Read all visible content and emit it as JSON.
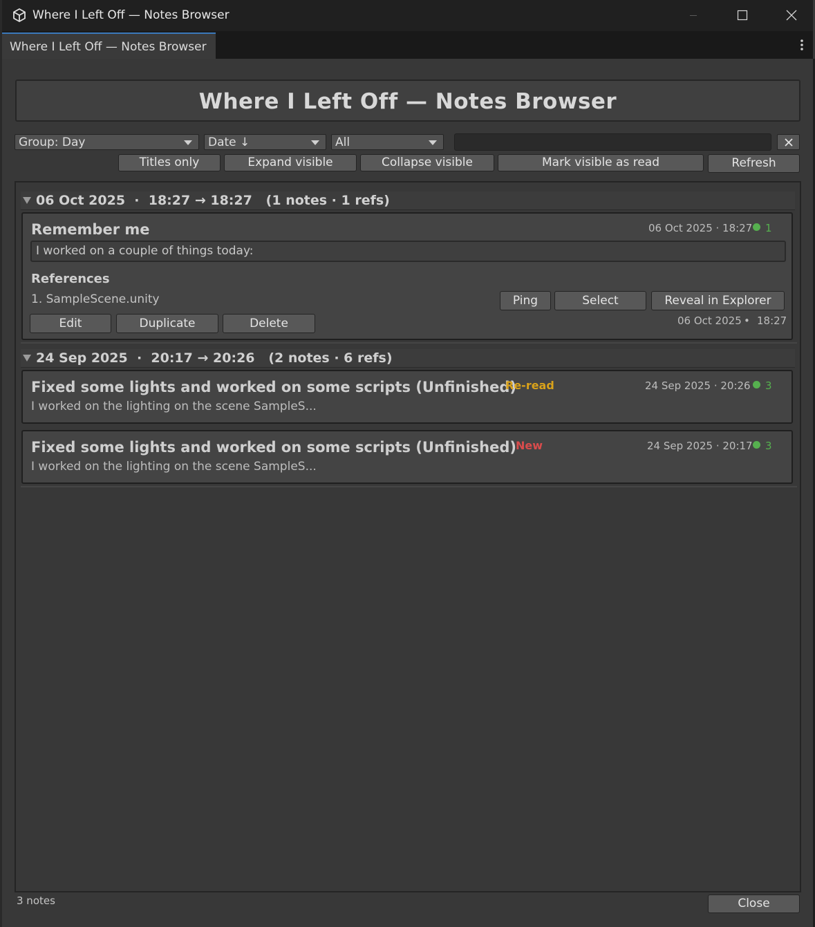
{
  "window": {
    "title": "Where I Left Off — Notes Browser",
    "tab_label": "Where I Left Off — Notes Browser",
    "header_title": "Where I Left Off — Notes Browser"
  },
  "toolbar": {
    "group_dropdown": "Group: Day",
    "sort_dropdown": "Date ↓",
    "filter_dropdown": "All",
    "search_value": "",
    "clear_label": "✕",
    "titles_only": "Titles only",
    "expand_visible": "Expand visible",
    "collapse_visible": "Collapse visible",
    "mark_visible_read": "Mark visible as read",
    "refresh": "Refresh"
  },
  "groups": [
    {
      "header": "06 Oct 2025  ·  18:27 → 18:27   (1 notes · 1 refs)",
      "notes": [
        {
          "title": "Remember me",
          "meta": "06 Oct 2025 · 18:27",
          "ref_count": "1",
          "preview": "I worked on a couple of things today:",
          "references_label": "References",
          "references": [
            {
              "label": "1. SampleScene.unity",
              "ping": "Ping",
              "select": "Select",
              "reveal": "Reveal in Explorer",
              "date": "06 Oct 2025",
              "time": "18:27"
            }
          ],
          "actions": {
            "edit": "Edit",
            "duplicate": "Duplicate",
            "delete": "Delete"
          }
        }
      ]
    },
    {
      "header": "24 Sep 2025  ·  20:17 → 20:26   (2 notes · 6 refs)",
      "notes": [
        {
          "title": "Fixed some lights and worked on some scripts (Unfinished)",
          "badge": "Re-read",
          "meta": "24 Sep 2025 · 20:26",
          "ref_count": "3",
          "snippet": "I worked on the lighting on the scene SampleS..."
        },
        {
          "title": "Fixed some lights and worked on some scripts (Unfinished)",
          "badge": "New",
          "meta": "24 Sep 2025 · 20:17",
          "ref_count": "3",
          "snippet": "I worked on the lighting on the scene SampleS..."
        }
      ]
    }
  ],
  "footer": {
    "count": "3 notes",
    "close": "Close"
  },
  "colors": {
    "badge_reread": "#d9a21a",
    "badge_new": "#d94c4c",
    "ref_dot": "#56b04f",
    "tab_accent": "#3a79bb"
  },
  "icons": {
    "app": "unity-cube-icon",
    "minimize": "minimize-icon",
    "maximize": "maximize-icon",
    "close": "close-icon",
    "menu": "kebab-menu-icon",
    "collapse": "triangle-down-icon",
    "dropdown": "caret-down-icon"
  }
}
